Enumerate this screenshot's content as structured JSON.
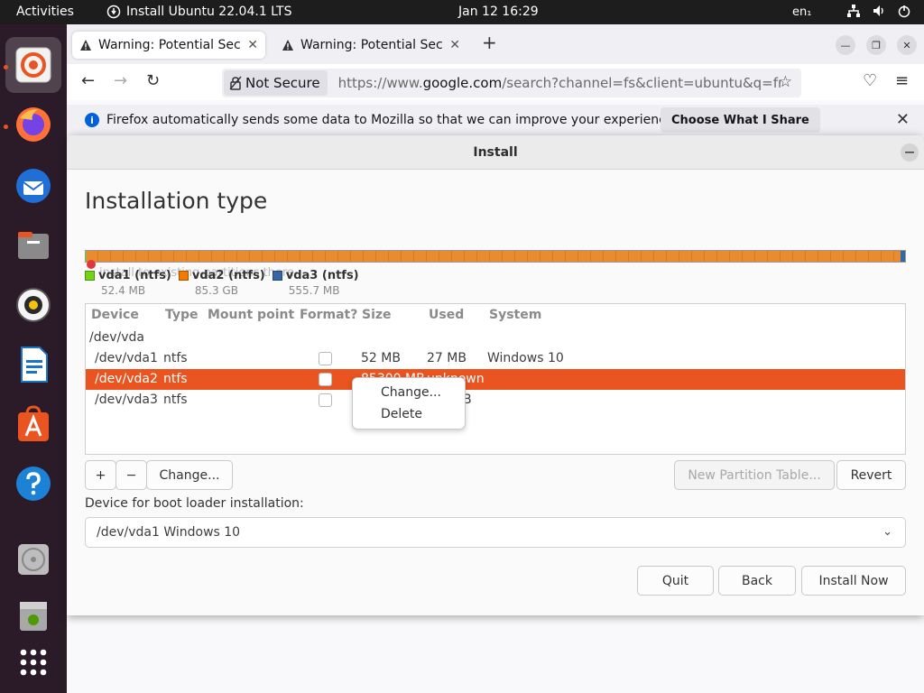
{
  "topbar": {
    "activities": "Activities",
    "app_name": "Install Ubuntu 22.04.1 LTS",
    "clock": "Jan 12  16:29",
    "language": "en₁"
  },
  "dock": {
    "items": [
      "ubuntu-installer-icon",
      "firefox-icon",
      "thunderbird-icon",
      "files-icon",
      "rhythmbox-icon",
      "libreoffice-writer-icon",
      "app-center-icon",
      "help-icon",
      "disc-icon",
      "trash-icon",
      "show-apps-icon"
    ]
  },
  "browser": {
    "tabs": [
      {
        "title": "Warning: Potential Securi"
      },
      {
        "title": "Warning: Potential Securi"
      }
    ],
    "new_tab": "+",
    "not_secure": "Not Secure",
    "url_prefix": "https://www.",
    "url_domain": "google.com",
    "url_rest": "/search?channel=fs&client=ubuntu&q=free+d",
    "infobar_text": "Firefox automatically sends some data to Mozilla so that we can improve your experience.",
    "infobar_button": "Choose What I Share"
  },
  "installer": {
    "window_title": "Install",
    "heading": "Installation type",
    "ghost_text": "install to existing partitions there",
    "legend": [
      {
        "name": "vda1 (ntfs)",
        "size": "52.4 MB",
        "color": "#73d216"
      },
      {
        "name": "vda2 (ntfs)",
        "size": "85.3 GB",
        "color": "#f57900"
      },
      {
        "name": "vda3 (ntfs)",
        "size": "555.7 MB",
        "color": "#3465a4"
      }
    ],
    "table": {
      "headers": [
        "Device",
        "Type",
        "Mount point",
        "Format?",
        "Size",
        "Used",
        "System"
      ],
      "rows": [
        {
          "device": "/dev/vda",
          "type": "",
          "size": "",
          "used": "",
          "system": ""
        },
        {
          "device": "/dev/vda1",
          "type": "ntfs",
          "size": "52 MB",
          "used": "27 MB",
          "system": "Windows 10"
        },
        {
          "device": "/dev/vda2",
          "type": "ntfs",
          "size": "85300 MB",
          "used": "unknown",
          "system": ""
        },
        {
          "device": "/dev/vda3",
          "type": "ntfs",
          "size": "",
          "used": "B",
          "system": ""
        }
      ]
    },
    "context_menu": [
      "Change...",
      "Delete"
    ],
    "buttons": {
      "add": "+",
      "remove": "−",
      "change": "Change...",
      "new_table": "New Partition Table...",
      "revert": "Revert",
      "quit": "Quit",
      "back": "Back",
      "install_now": "Install Now"
    },
    "boot_label": "Device for boot loader installation:",
    "boot_value": "/dev/vda1 Windows 10"
  },
  "colors": {
    "accent": "#e95420",
    "topbar": "#1d1d1d",
    "dock": "#2b1a28"
  }
}
